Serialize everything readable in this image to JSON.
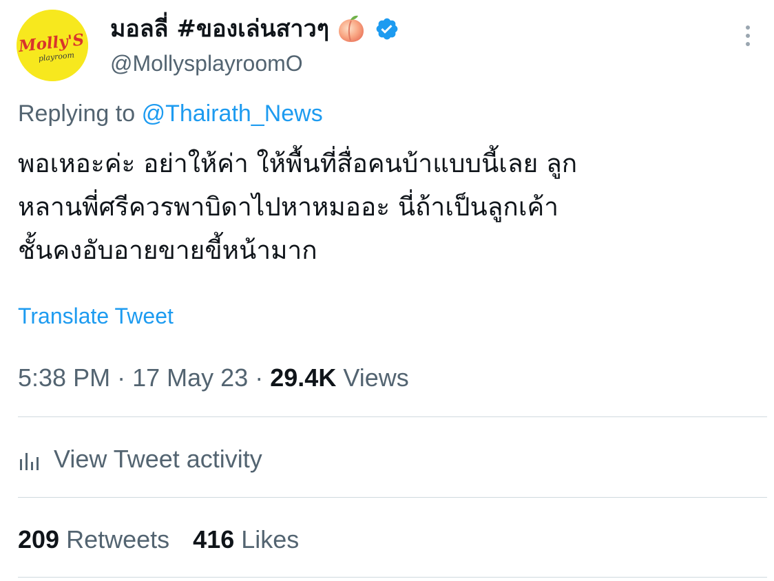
{
  "author": {
    "display_name": "มอลลี่ #ของเล่นสาวๆ",
    "handle": "@MollysplayroomO",
    "avatar_logo_text": "Molly'S",
    "avatar_logo_subtext": "playroom",
    "emoji_icon": "peach-emoji-icon",
    "verified_icon": "verified-badge-icon",
    "avatar_color": "#f7e81e"
  },
  "reply": {
    "prefix": "Replying to",
    "mention": "@Thairath_News"
  },
  "tweet": {
    "text": "พอเหอะค่ะ อย่าให้ค่า ให้พื้นที่สื่อคนบ้าแบบนี้เลย ลูก\nหลานพี่ศรีควรพาบิดาไปหาหมออะ นี่ถ้าเป็นลูกเค้า\nชั้นคงอับอายขายขี้หน้ามาก",
    "translate_label": "Translate Tweet"
  },
  "meta": {
    "time": "5:38 PM",
    "date": "17 May 23",
    "separator": "·",
    "views_count": "29.4K",
    "views_label": "Views"
  },
  "activity": {
    "label": "View Tweet activity",
    "icon": "bar-chart-icon"
  },
  "stats": {
    "retweets_count": "209",
    "retweets_label": "Retweets",
    "likes_count": "416",
    "likes_label": "Likes"
  },
  "colors": {
    "link": "#1d9bf0",
    "secondary_text": "#536471",
    "primary_text": "#0f1419",
    "divider": "#cfd9de"
  }
}
